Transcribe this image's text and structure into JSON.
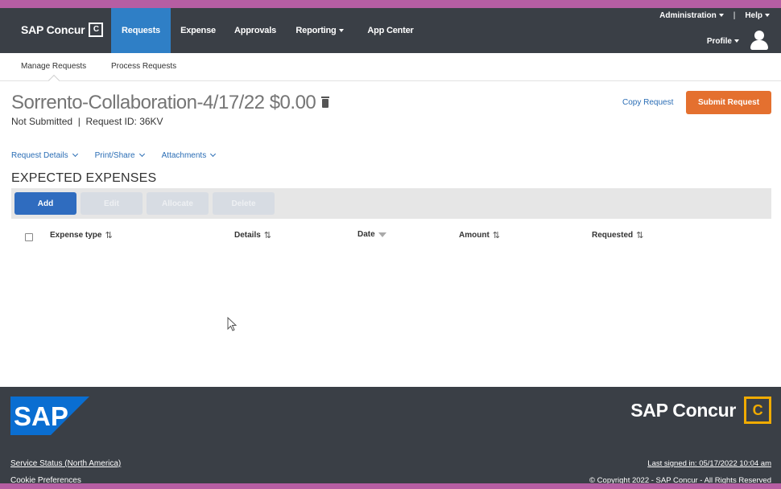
{
  "brand": {
    "name": "SAP Concur",
    "mark": "C"
  },
  "nav": {
    "tabs": [
      {
        "label": "Requests",
        "active": true
      },
      {
        "label": "Expense"
      },
      {
        "label": "Approvals"
      },
      {
        "label": "Reporting"
      },
      {
        "label": "App Center"
      }
    ],
    "administration": "Administration",
    "separator": "|",
    "help": "Help",
    "profile": "Profile"
  },
  "subnav": {
    "manage": "Manage Requests",
    "process": "Process Requests"
  },
  "request": {
    "title": "Sorrento-Collaboration-4/17/22 $0.00",
    "status_line": "Not Submitted  |  Request ID: 36KV",
    "copy_label": "Copy Request",
    "submit_label": "Submit Request"
  },
  "menus": {
    "details": "Request Details",
    "print": "Print/Share",
    "attachments": "Attachments"
  },
  "section": {
    "title": "EXPECTED EXPENSES"
  },
  "toolbar": {
    "add": "Add",
    "edit": "Edit",
    "allocate": "Allocate",
    "delete": "Delete"
  },
  "table": {
    "columns": {
      "expense_type": "Expense type",
      "details": "Details",
      "date": "Date",
      "amount": "Amount",
      "requested": "Requested"
    },
    "sort_glyph": "⇅"
  },
  "footer": {
    "sap": "SAP",
    "concur_name": "SAP Concur",
    "concur_mark": "C",
    "service_status": "Service Status (North America)",
    "cookie": "Cookie Preferences",
    "last_signed": "Last signed in: 05/17/2022 10:04 am",
    "copyright": "© Copyright 2022 - SAP Concur - All Rights Reserved"
  },
  "colors": {
    "nav_bg": "#3a3f46",
    "active_tab": "#2f7fc6",
    "submit": "#e4702f",
    "primary_btn": "#2f6cbf",
    "link": "#2a6db5",
    "concur_gold": "#f0ab00",
    "sap_blue": "#0a6ed1"
  }
}
